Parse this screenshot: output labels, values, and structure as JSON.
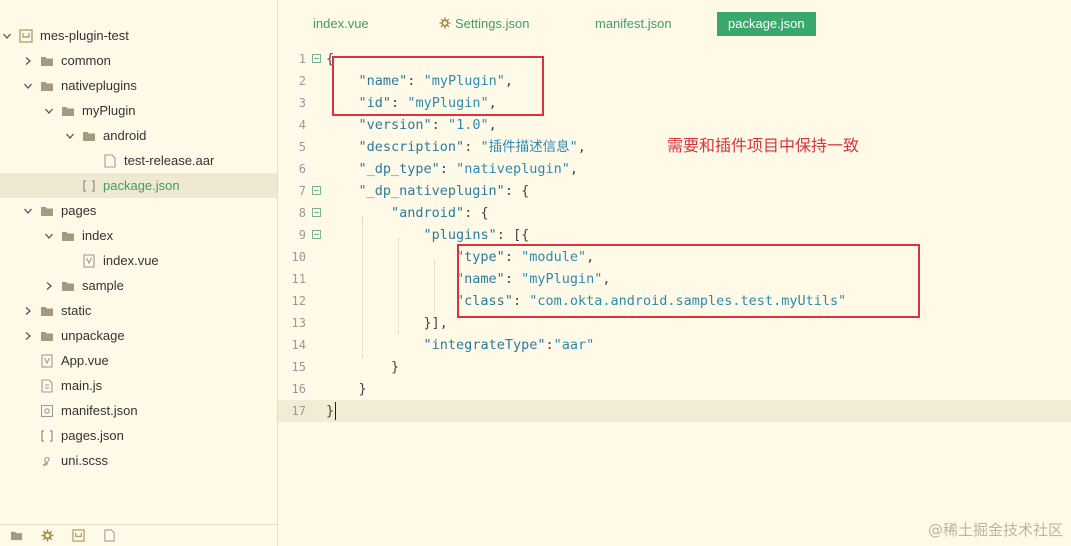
{
  "sidebar": {
    "items": [
      {
        "label": "mes-plugin-test",
        "icon": "project-icon",
        "arrow": "down",
        "indent": 0
      },
      {
        "label": "common",
        "icon": "folder-icon",
        "arrow": "right",
        "indent": 1
      },
      {
        "label": "nativeplugins",
        "icon": "folder-icon",
        "arrow": "down",
        "indent": 1
      },
      {
        "label": "myPlugin",
        "icon": "folder-icon",
        "arrow": "down",
        "indent": 2
      },
      {
        "label": "android",
        "icon": "folder-icon",
        "arrow": "down",
        "indent": 3
      },
      {
        "label": "test-release.aar",
        "icon": "file-icon",
        "arrow": "",
        "indent": 4
      },
      {
        "label": "package.json",
        "icon": "json-icon",
        "arrow": "",
        "indent": 3,
        "selected": true
      },
      {
        "label": "pages",
        "icon": "folder-icon",
        "arrow": "down",
        "indent": 1
      },
      {
        "label": "index",
        "icon": "folder-icon",
        "arrow": "down",
        "indent": 2
      },
      {
        "label": "index.vue",
        "icon": "vue-file-icon",
        "arrow": "",
        "indent": 3
      },
      {
        "label": "sample",
        "icon": "folder-icon",
        "arrow": "right",
        "indent": 2
      },
      {
        "label": "static",
        "icon": "folder-icon",
        "arrow": "right",
        "indent": 1
      },
      {
        "label": "unpackage",
        "icon": "folder-icon",
        "arrow": "right",
        "indent": 1
      },
      {
        "label": "App.vue",
        "icon": "vue-file-icon",
        "arrow": "",
        "indent": 1
      },
      {
        "label": "main.js",
        "icon": "js-file-icon",
        "arrow": "",
        "indent": 1
      },
      {
        "label": "manifest.json",
        "icon": "manifest-icon",
        "arrow": "",
        "indent": 1
      },
      {
        "label": "pages.json",
        "icon": "json-icon",
        "arrow": "",
        "indent": 1
      },
      {
        "label": "uni.scss",
        "icon": "scss-icon",
        "arrow": "",
        "indent": 1
      }
    ]
  },
  "tabs": [
    {
      "label": "index.vue",
      "active": false
    },
    {
      "label": "Settings.json",
      "active": false,
      "icon": "gear-icon"
    },
    {
      "label": "manifest.json",
      "active": false
    },
    {
      "label": "package.json",
      "active": true
    }
  ],
  "editor": {
    "lines": [
      {
        "n": "1",
        "text": "{",
        "fold": true
      },
      {
        "n": "2",
        "text": "    \"name\": \"myPlugin\","
      },
      {
        "n": "3",
        "text": "    \"id\": \"myPlugin\","
      },
      {
        "n": "4",
        "text": "    \"version\": \"1.0\","
      },
      {
        "n": "5",
        "text": "    \"description\": \"插件描述信息\","
      },
      {
        "n": "6",
        "text": "    \"_dp_type\": \"nativeplugin\","
      },
      {
        "n": "7",
        "text": "    \"_dp_nativeplugin\": {",
        "fold": true
      },
      {
        "n": "8",
        "text": "        \"android\": {",
        "fold": true
      },
      {
        "n": "9",
        "text": "            \"plugins\": [{",
        "fold": true
      },
      {
        "n": "10",
        "text": "                \"type\": \"module\","
      },
      {
        "n": "11",
        "text": "                \"name\": \"myPlugin\","
      },
      {
        "n": "12",
        "text": "                \"class\": \"com.okta.android.samples.test.myUtils\""
      },
      {
        "n": "13",
        "text": "            }],"
      },
      {
        "n": "14",
        "text": "            \"integrateType\":\"aar\""
      },
      {
        "n": "15",
        "text": "        }"
      },
      {
        "n": "16",
        "text": "    }"
      },
      {
        "n": "17",
        "text": "}",
        "current": true
      }
    ]
  },
  "annotation": "需要和插件项目中保持一致",
  "watermark": "@稀土掘金技术社区",
  "colors": {
    "accent": "#3aa76d",
    "annotation": "#d9333f",
    "background": "#fffae8"
  }
}
